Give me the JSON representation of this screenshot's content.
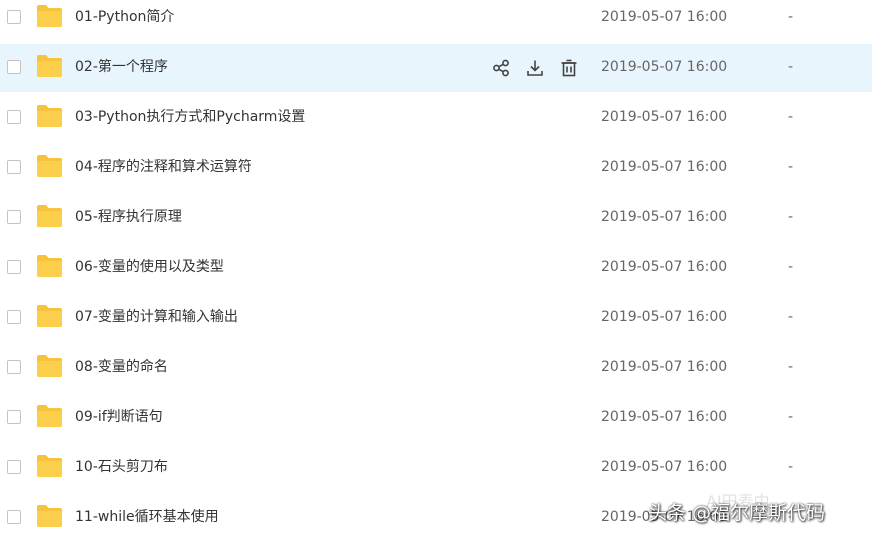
{
  "files": [
    {
      "name": "01-Python简介",
      "time": "2019-05-07 16:00",
      "size": "-"
    },
    {
      "name": "02-第一个程序",
      "time": "2019-05-07 16:00",
      "size": "-"
    },
    {
      "name": "03-Python执行方式和Pycharm设置",
      "time": "2019-05-07 16:00",
      "size": "-"
    },
    {
      "name": "04-程序的注释和算术运算符",
      "time": "2019-05-07 16:00",
      "size": "-"
    },
    {
      "name": "05-程序执行原理",
      "time": "2019-05-07 16:00",
      "size": "-"
    },
    {
      "name": "06-变量的使用以及类型",
      "time": "2019-05-07 16:00",
      "size": "-"
    },
    {
      "name": "07-变量的计算和输入输出",
      "time": "2019-05-07 16:00",
      "size": "-"
    },
    {
      "name": "08-变量的命名",
      "time": "2019-05-07 16:00",
      "size": "-"
    },
    {
      "name": "09-if判断语句",
      "time": "2019-05-07 16:00",
      "size": "-"
    },
    {
      "name": "10-石头剪刀布",
      "time": "2019-05-07 16:00",
      "size": "-"
    },
    {
      "name": "11-while循环基本使用",
      "time": "2019-05-07 16:00",
      "size": "-"
    }
  ],
  "hovered_row_index": 1,
  "hover_actions": [
    {
      "icon": "share-icon"
    },
    {
      "icon": "download-icon"
    },
    {
      "icon": "delete-icon"
    }
  ],
  "watermark": {
    "main": "头条 @福尔摩斯代码",
    "faint": "AI田麦中"
  },
  "colors": {
    "hover_row": "#e9f5fd",
    "folder": "#f8c33c",
    "text": "#333333",
    "meta_text": "#666666"
  }
}
